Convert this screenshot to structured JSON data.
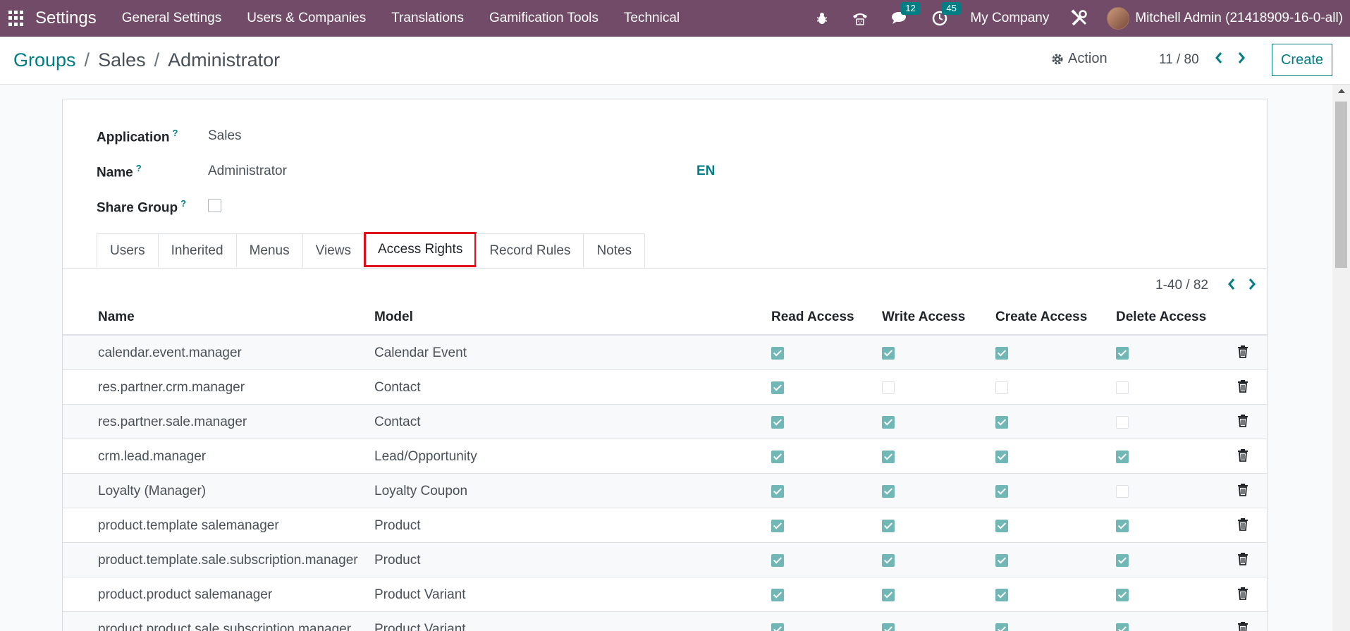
{
  "navbar": {
    "brand": "Settings",
    "menu": [
      "General Settings",
      "Users & Companies",
      "Translations",
      "Gamification Tools",
      "Technical"
    ],
    "messages_count": "12",
    "activities_count": "45",
    "company": "My Company",
    "user": "Mitchell Admin (21418909-16-0-all)",
    "bg_color": "#714b67"
  },
  "breadcrumb": {
    "root": "Groups",
    "middle": "Sales",
    "current": "Administrator"
  },
  "control": {
    "action_label": "Action",
    "pager": "11 / 80",
    "create_label": "Create"
  },
  "form": {
    "application_label": "Application",
    "application_value": "Sales",
    "name_label": "Name",
    "name_value": "Administrator",
    "lang": "EN",
    "share_group_label": "Share Group",
    "share_group_checked": false,
    "help_marker": "?"
  },
  "tabs": [
    "Users",
    "Inherited",
    "Menus",
    "Views",
    "Access Rights",
    "Record Rules",
    "Notes"
  ],
  "active_tab": "Access Rights",
  "list": {
    "pager": "1-40 / 82",
    "columns": [
      "Name",
      "Model",
      "Read Access",
      "Write Access",
      "Create Access",
      "Delete Access"
    ],
    "rows": [
      {
        "name": "calendar.event.manager",
        "model": "Calendar Event",
        "read": true,
        "write": true,
        "create": true,
        "delete": true
      },
      {
        "name": "res.partner.crm.manager",
        "model": "Contact",
        "read": true,
        "write": false,
        "create": false,
        "delete": false
      },
      {
        "name": "res.partner.sale.manager",
        "model": "Contact",
        "read": true,
        "write": true,
        "create": true,
        "delete": false
      },
      {
        "name": "crm.lead.manager",
        "model": "Lead/Opportunity",
        "read": true,
        "write": true,
        "create": true,
        "delete": true
      },
      {
        "name": "Loyalty (Manager)",
        "model": "Loyalty Coupon",
        "read": true,
        "write": true,
        "create": true,
        "delete": false
      },
      {
        "name": "product.template salemanager",
        "model": "Product",
        "read": true,
        "write": true,
        "create": true,
        "delete": true
      },
      {
        "name": "product.template.sale.subscription.manager",
        "model": "Product",
        "read": true,
        "write": true,
        "create": true,
        "delete": true
      },
      {
        "name": "product.product salemanager",
        "model": "Product Variant",
        "read": true,
        "write": true,
        "create": true,
        "delete": true
      },
      {
        "name": "product.product.sale.subscription.manager",
        "model": "Product Variant",
        "read": true,
        "write": true,
        "create": true,
        "delete": true
      }
    ]
  },
  "colors": {
    "accent": "#017e84",
    "checkbox_on": "#71b7b5",
    "highlight": "#e0101a"
  }
}
